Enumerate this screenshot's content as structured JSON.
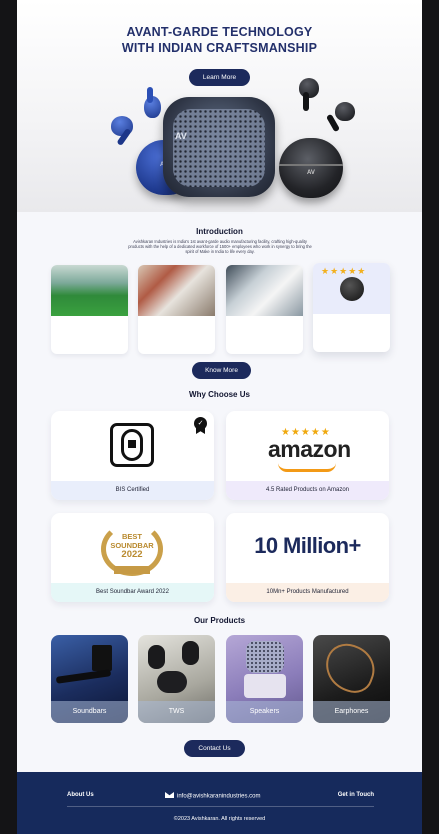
{
  "hero": {
    "title_line1": "AVANT-GARDE TECHNOLOGY",
    "title_line2": "WITH INDIAN CRAFTSMANSHIP",
    "learn_more_label": "Learn More"
  },
  "intro": {
    "title": "Introduction",
    "text": "Avishkaran Industries is India's 1st avant-garde audio manufacturing facility, crafting high-quality products with the help of a dedicated workforce of 1500+ employees who work in synergy to bring the spirit of Make in India to life every day.",
    "stars": "★★★★★",
    "know_more_label": "Know More"
  },
  "why": {
    "title": "Why Choose Us",
    "cards": [
      {
        "caption": "BIS Certified"
      },
      {
        "caption": "4.5 Rated Products on Amazon",
        "logo_text": "amazon",
        "stars": "★★★★★"
      },
      {
        "caption": "Best Soundbar Award 2022",
        "award_line1": "BEST",
        "award_line2": "SOUNDBAR",
        "award_year": "2022"
      },
      {
        "caption": "10Mn+ Products Manufactured",
        "big_text": "10 Million+"
      }
    ]
  },
  "products": {
    "title": "Our Products",
    "items": [
      {
        "label": "Soundbars"
      },
      {
        "label": "TWS"
      },
      {
        "label": "Speakers"
      },
      {
        "label": "Earphones"
      }
    ],
    "contact_label": "Contact Us"
  },
  "footer": {
    "about_label": "About Us",
    "email": "info@avishkaranindustries.com",
    "get_in_touch_label": "Get in Touch",
    "copyright": "©2023 Avishkaran. All rights reserved"
  },
  "colors": {
    "navy": "#1c2a5c",
    "footer_bg": "#162a5c",
    "star_gold": "#f2b01e"
  }
}
